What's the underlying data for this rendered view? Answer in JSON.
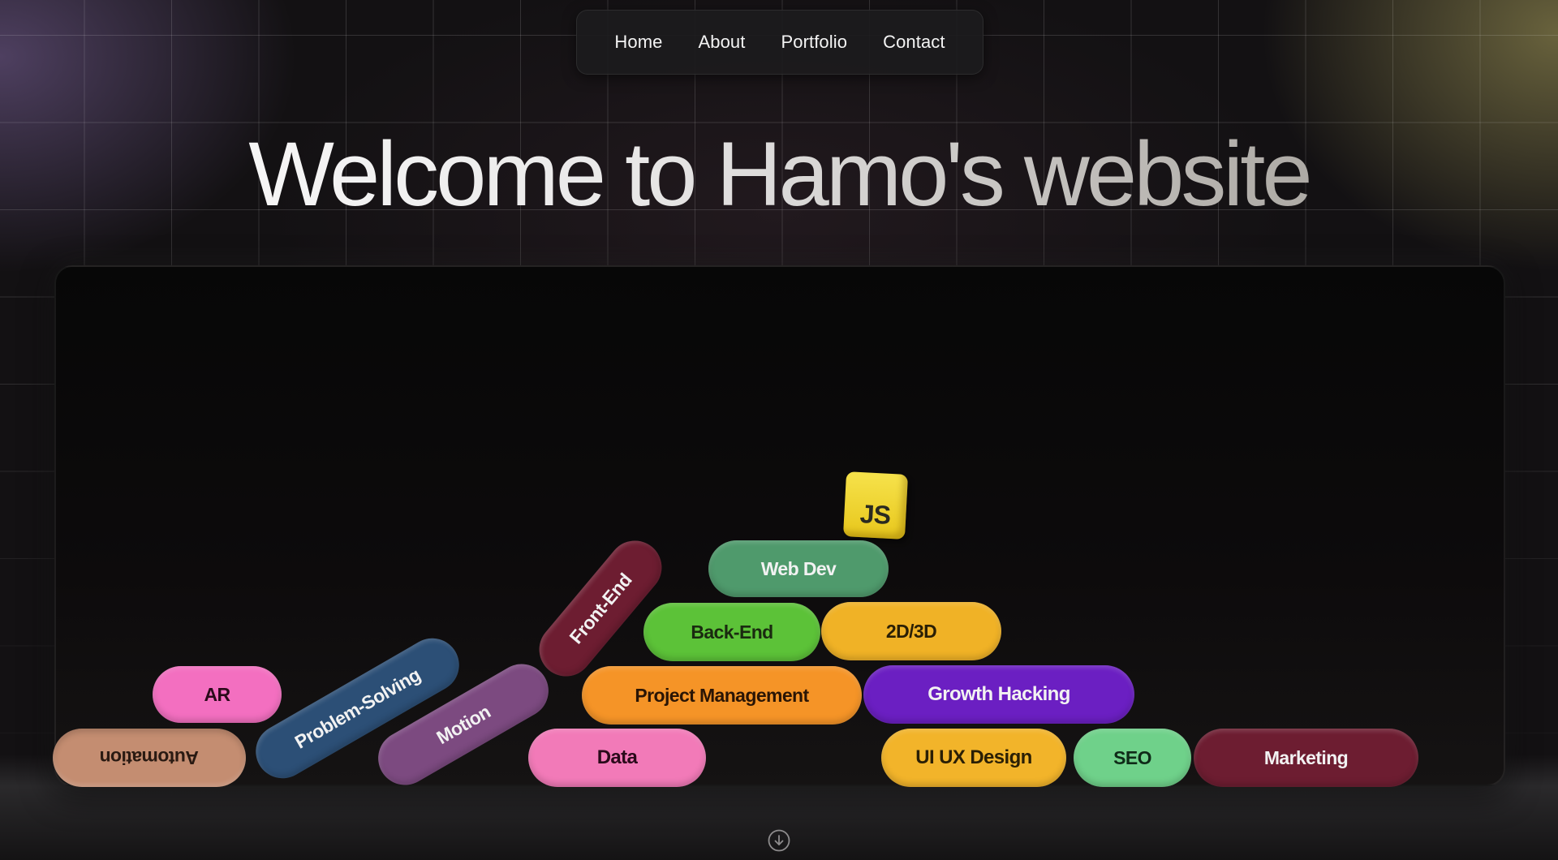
{
  "nav": {
    "items": [
      "Home",
      "About",
      "Portfolio",
      "Contact"
    ]
  },
  "hero": {
    "title": "Welcome to Hamo's website"
  },
  "skills": [
    {
      "label": "JS",
      "color": "#efd431",
      "text_color": "#2a2a20"
    },
    {
      "label": "Web Dev",
      "color": "#4f9a6c",
      "text_color": "#f2f2f2"
    },
    {
      "label": "Front-End",
      "color": "#6d1d31",
      "text_color": "#f2f2f2"
    },
    {
      "label": "Back-End",
      "color": "#5cc238",
      "text_color": "#1a2a10"
    },
    {
      "label": "2D/3D",
      "color": "#f0b226",
      "text_color": "#2a1f05"
    },
    {
      "label": "Project Management",
      "color": "#f59427",
      "text_color": "#2a1505"
    },
    {
      "label": "Growth Hacking",
      "color": "#6b1fc2",
      "text_color": "#f2f2f2"
    },
    {
      "label": "AR",
      "color": "#f36fc0",
      "text_color": "#2a0a1a"
    },
    {
      "label": "Problem-Solving",
      "color": "#2c4f76",
      "text_color": "#f2f2f2"
    },
    {
      "label": "Motion",
      "color": "#7c4a80",
      "text_color": "#f2f2f2"
    },
    {
      "label": "Automation",
      "color": "#c48d71",
      "text_color": "#2a1a12"
    },
    {
      "label": "Data",
      "color": "#f27ab8",
      "text_color": "#2a0a1a"
    },
    {
      "label": "UI UX Design",
      "color": "#f2b42a",
      "text_color": "#2a1f05"
    },
    {
      "label": "SEO",
      "color": "#6fd18a",
      "text_color": "#0f2a18"
    },
    {
      "label": "Marketing",
      "color": "#6d1d31",
      "text_color": "#f2f2f2"
    }
  ],
  "scroll": {
    "icon": "arrow-down-circle-icon"
  }
}
